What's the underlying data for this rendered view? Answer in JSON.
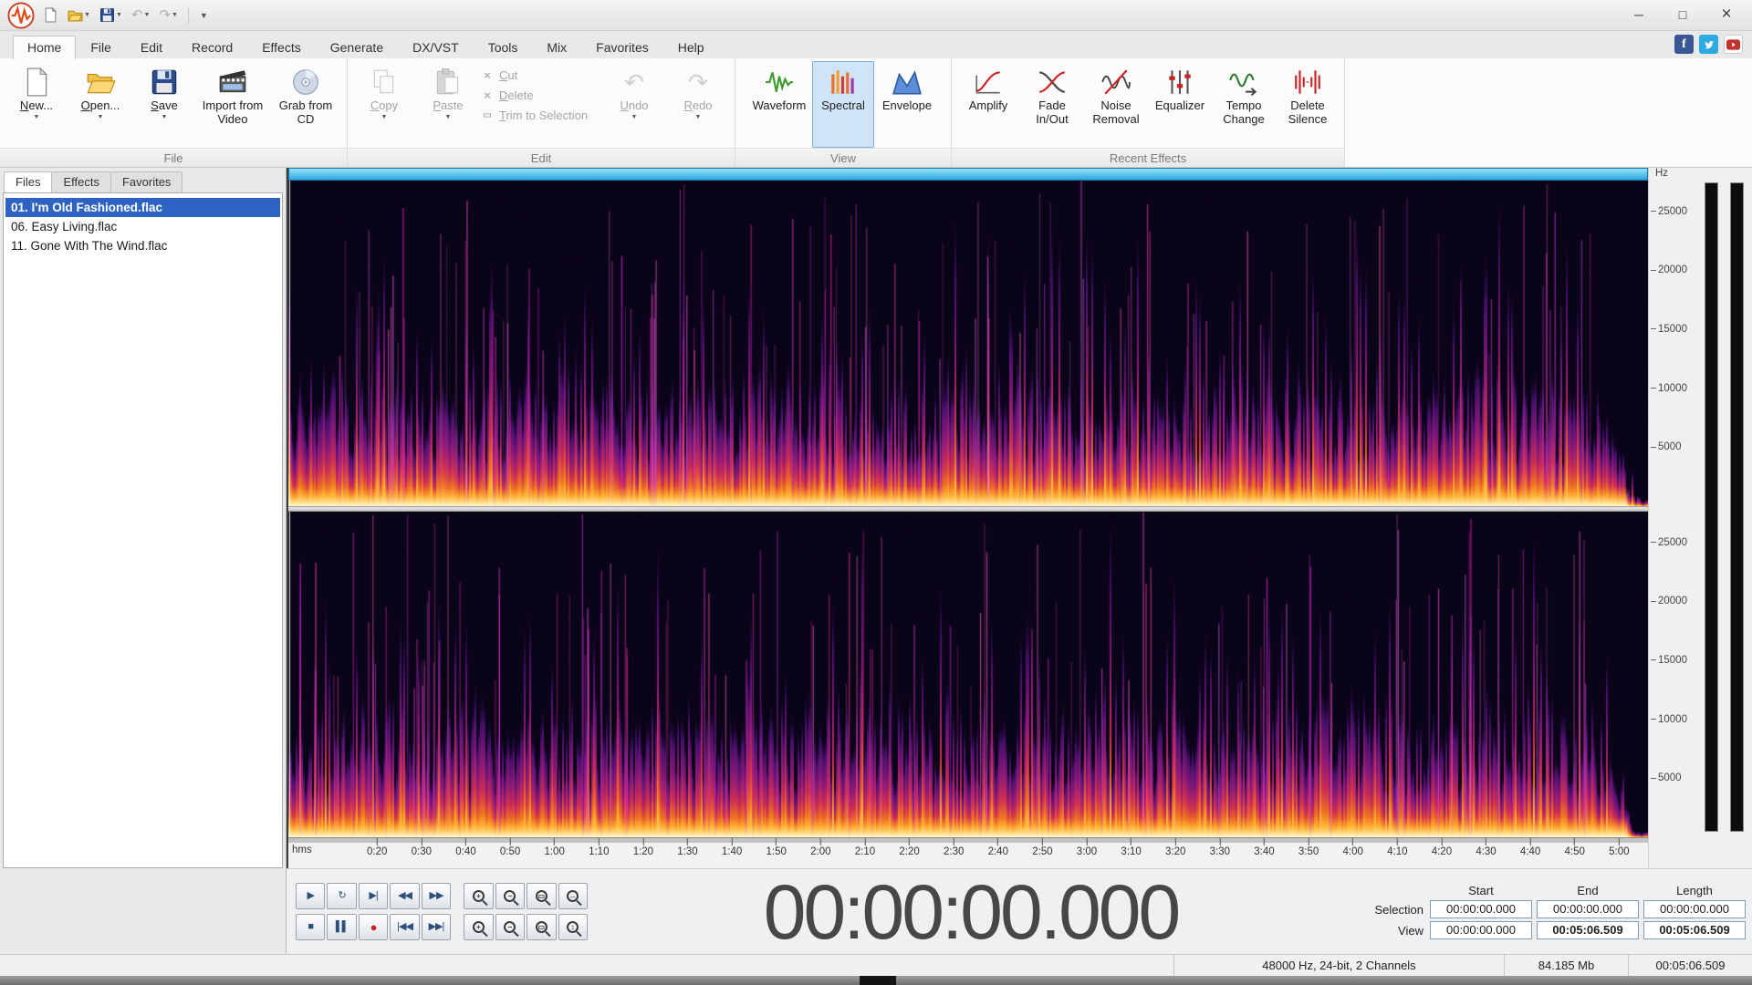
{
  "titlebar": {
    "quick_access_icons": [
      "app-logo",
      "new-document",
      "open-folder",
      "save",
      "undo",
      "redo",
      "customize-toolbar"
    ],
    "window_buttons": {
      "minimize": "─",
      "maximize": "□",
      "close": "×"
    },
    "social_icons": [
      "facebook",
      "twitter",
      "youtube"
    ]
  },
  "ribbon_tabs": [
    {
      "label": "Home",
      "active": true
    },
    {
      "label": "File"
    },
    {
      "label": "Edit"
    },
    {
      "label": "Record"
    },
    {
      "label": "Effects"
    },
    {
      "label": "Generate"
    },
    {
      "label": "DX/VST"
    },
    {
      "label": "Tools"
    },
    {
      "label": "Mix"
    },
    {
      "label": "Favorites"
    },
    {
      "label": "Help"
    }
  ],
  "ribbon": {
    "file_group": {
      "label": "File",
      "items": [
        {
          "label": "New...",
          "icon": "new-document-icon",
          "dropdown": true
        },
        {
          "label": "Open...",
          "icon": "open-folder-icon",
          "dropdown": true
        },
        {
          "label": "Save",
          "icon": "save-icon",
          "dropdown": true
        },
        {
          "label": "Import from Video",
          "icon": "import-video-icon"
        },
        {
          "label": "Grab from CD",
          "icon": "grab-cd-icon"
        }
      ]
    },
    "edit_group": {
      "label": "Edit",
      "big_items": [
        {
          "label": "Copy",
          "icon": "copy-icon",
          "dropdown": true,
          "disabled": true
        },
        {
          "label": "Paste",
          "icon": "paste-icon",
          "dropdown": true,
          "disabled": true
        }
      ],
      "small_items": [
        {
          "label": "Cut",
          "icon": "cut-icon",
          "disabled": true
        },
        {
          "label": "Delete",
          "icon": "delete-icon",
          "disabled": true
        },
        {
          "label": "Trim to Selection",
          "icon": "trim-icon",
          "disabled": true
        }
      ],
      "history_items": [
        {
          "label": "Undo",
          "icon": "undo-icon",
          "glyph": "↶",
          "dropdown": true,
          "disabled": true
        },
        {
          "label": "Redo",
          "icon": "redo-icon",
          "glyph": "↷",
          "dropdown": true,
          "disabled": true
        }
      ]
    },
    "view_group": {
      "label": "View",
      "items": [
        {
          "label": "Waveform",
          "icon": "waveform-icon"
        },
        {
          "label": "Spectral",
          "icon": "spectral-icon",
          "active": true
        },
        {
          "label": "Envelope",
          "icon": "envelope-icon"
        }
      ]
    },
    "effects_group": {
      "label": "Recent Effects",
      "items": [
        {
          "label": "Amplify",
          "icon": "amplify-icon"
        },
        {
          "label": "Fade In/Out",
          "icon": "fade-icon"
        },
        {
          "label": "Noise Removal",
          "icon": "noise-removal-icon"
        },
        {
          "label": "Equalizer",
          "icon": "equalizer-icon"
        },
        {
          "label": "Tempo Change",
          "icon": "tempo-icon"
        },
        {
          "label": "Delete Silence",
          "icon": "delete-silence-icon"
        }
      ]
    }
  },
  "sidebar": {
    "tabs": [
      {
        "label": "Files",
        "active": true
      },
      {
        "label": "Effects"
      },
      {
        "label": "Favorites"
      }
    ],
    "files": [
      {
        "label": "01. I'm Old Fashioned.flac",
        "selected": true
      },
      {
        "label": "06. Easy Living.flac"
      },
      {
        "label": "11. Gone With The Wind.flac"
      }
    ]
  },
  "spectrogram": {
    "freq_unit": "Hz",
    "freq_ticks": [
      "25000",
      "20000",
      "15000",
      "10000",
      "5000"
    ],
    "channels": 2,
    "duration_seconds": 306.509,
    "palette": {
      "background": "#0a0418",
      "low": "#47106b",
      "mid": "#cf2f52",
      "high": "#f07820",
      "peak": "#fff3c0"
    }
  },
  "timeline": {
    "unit_label": "hms",
    "ticks": [
      "0:20",
      "0:30",
      "0:40",
      "0:50",
      "1:00",
      "1:10",
      "1:20",
      "1:30",
      "1:40",
      "1:50",
      "2:00",
      "2:10",
      "2:20",
      "2:30",
      "2:40",
      "2:50",
      "3:00",
      "3:10",
      "3:20",
      "3:30",
      "3:40",
      "3:50",
      "4:00",
      "4:10",
      "4:20",
      "4:30",
      "4:40",
      "4:50",
      "5:00"
    ]
  },
  "transport": {
    "rows": [
      [
        {
          "name": "play-button",
          "glyph": "▶"
        },
        {
          "name": "loop-button",
          "glyph": "↻"
        },
        {
          "name": "play-file-button",
          "glyph": "▶|"
        },
        {
          "name": "rewind-button",
          "glyph": "◀◀"
        },
        {
          "name": "fast-forward-button",
          "glyph": "▶▶"
        },
        {
          "name": "zoom-in-button",
          "mag": "+"
        },
        {
          "name": "zoom-out-button",
          "mag": "−"
        },
        {
          "name": "zoom-selection-button",
          "mag": "▭"
        },
        {
          "name": "zoom-all-button",
          "mag": "↔"
        }
      ],
      [
        {
          "name": "stop-button",
          "glyph": "■"
        },
        {
          "name": "pause-button",
          "glyph": "▌▌"
        },
        {
          "name": "record-button",
          "glyph": "●",
          "record": true
        },
        {
          "name": "go-to-start-button",
          "glyph": "|◀◀"
        },
        {
          "name": "go-to-end-button",
          "glyph": "▶▶|"
        },
        {
          "name": "zoom-vertical-in-button",
          "mag": "+"
        },
        {
          "name": "zoom-vertical-out-button",
          "mag": "−"
        },
        {
          "name": "zoom-to-selection-button",
          "mag": "▭"
        },
        {
          "name": "zoom-full-button",
          "mag": "↕"
        }
      ]
    ]
  },
  "time_display": "00:00:00.000",
  "selection_panel": {
    "headers": [
      "Start",
      "End",
      "Length"
    ],
    "rows": [
      {
        "label": "Selection",
        "start": "00:00:00.000",
        "end": "00:00:00.000",
        "length": "00:00:00.000"
      },
      {
        "label": "View",
        "start": "00:00:00.000",
        "end": "00:05:06.509",
        "length": "00:05:06.509"
      }
    ]
  },
  "status_bar": {
    "format": "48000 Hz, 24-bit, 2 Channels",
    "file_size": "84.185 Mb",
    "duration": "00:05:06.509"
  }
}
